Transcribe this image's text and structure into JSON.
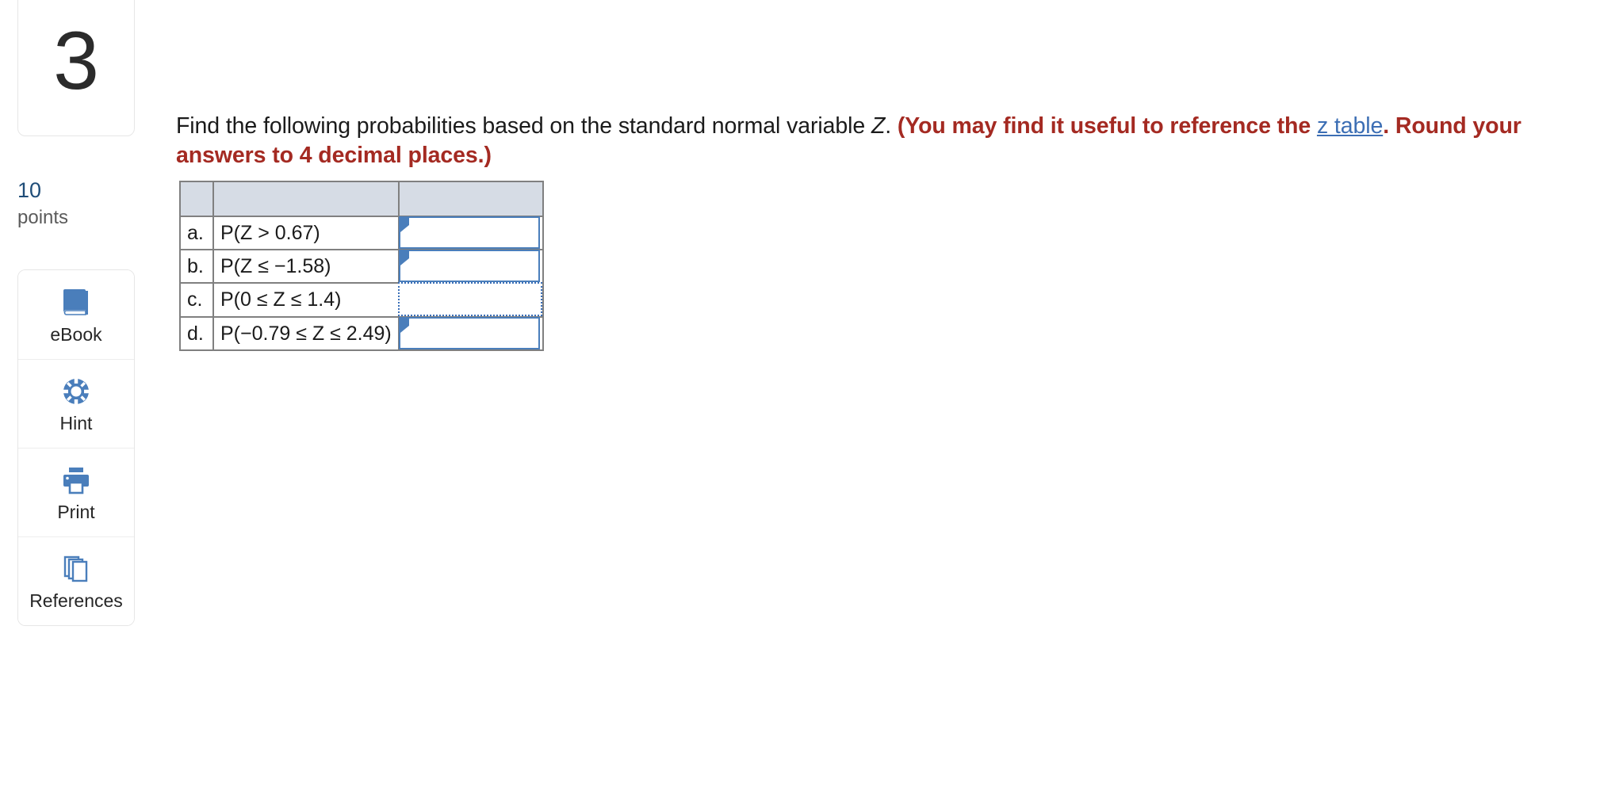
{
  "question": {
    "number": "3",
    "points_value": "10",
    "points_label": "points",
    "prompt_part1": "Find the following probabilities based on the standard normal variable ",
    "prompt_variable": "Z",
    "prompt_part2": ". ",
    "prompt_bold1": "(You may find it useful to reference the ",
    "prompt_link": "z table",
    "prompt_bold2": ". Round your answers to 4 decimal places.)"
  },
  "tools": {
    "items": [
      {
        "label": "eBook",
        "icon": "book-icon"
      },
      {
        "label": "Hint",
        "icon": "lifebuoy-icon"
      },
      {
        "label": "Print",
        "icon": "printer-icon"
      },
      {
        "label": "References",
        "icon": "copy-pages-icon"
      }
    ]
  },
  "answer_table": {
    "header": {
      "letter": "",
      "expression": "",
      "answer": ""
    },
    "rows": [
      {
        "letter": "a.",
        "expression": "P(Z > 0.67)",
        "answer": "",
        "state": "solid"
      },
      {
        "letter": "b.",
        "expression": "P(Z ≤ −1.58)",
        "answer": "",
        "state": "solid"
      },
      {
        "letter": "c.",
        "expression": "P(0 ≤ Z ≤ 1.4)",
        "answer": "",
        "state": "dotted"
      },
      {
        "letter": "d.",
        "expression": "P(−0.79 ≤ Z ≤ 2.49)",
        "answer": "",
        "state": "solid"
      }
    ]
  },
  "colors": {
    "accent_blue": "#4a7ebb",
    "link_blue": "#3c6eb4",
    "points_blue": "#1f4d78",
    "alert_red": "#a42a22",
    "header_fill": "#d6dce5",
    "table_border": "#808080"
  }
}
